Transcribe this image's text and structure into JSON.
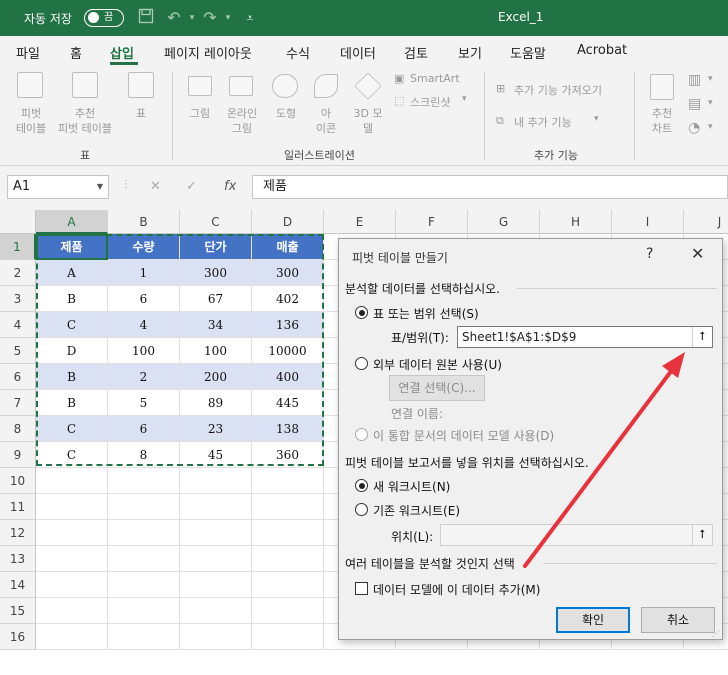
{
  "titlebar": {
    "autosave_label": "자동 저장",
    "autosave_state": "끔",
    "window_title": "Excel_1"
  },
  "tabs": [
    "파일",
    "홈",
    "삽입",
    "페이지 레이아웃",
    "수식",
    "데이터",
    "검토",
    "보기",
    "도움말",
    "Acrobat"
  ],
  "active_tab": "삽입",
  "ribbon": {
    "pivot_label_1": "피벗",
    "pivot_label_2": "테이블",
    "rec_pivot_1": "추천",
    "rec_pivot_2": "피벗 테이블",
    "table_label": "표",
    "group_table": "표",
    "pictures": "그림",
    "online_1": "온라인",
    "online_2": "그림",
    "shapes": "도형",
    "icons_1": "아",
    "icons_2": "이콘",
    "model3d_1": "3D 모",
    "model3d_2": "델",
    "smartart": "SmartArt",
    "screenshot": "스크린샷",
    "group_illustrations": "일러스트레이션",
    "get_addins": "추가 기능 가져오기",
    "my_addins": "내 추가 기능",
    "group_addins": "추가 기능",
    "rec_charts_1": "추천",
    "rec_charts_2": "차트"
  },
  "formula_bar": {
    "name_box": "A1",
    "fx": "fx",
    "content": "제품"
  },
  "columns": [
    "A",
    "B",
    "C",
    "D",
    "E",
    "F",
    "G",
    "H",
    "I",
    "J"
  ],
  "rows": [
    "1",
    "2",
    "3",
    "4",
    "5",
    "6",
    "7",
    "8",
    "9",
    "10",
    "11",
    "12",
    "13",
    "14",
    "15",
    "16"
  ],
  "table": {
    "headers": [
      "제품",
      "수량",
      "단가",
      "매출"
    ],
    "rows": [
      [
        "A",
        "1",
        "300",
        "300"
      ],
      [
        "B",
        "6",
        "67",
        "402"
      ],
      [
        "C",
        "4",
        "34",
        "136"
      ],
      [
        "D",
        "100",
        "100",
        "10000"
      ],
      [
        "B",
        "2",
        "200",
        "400"
      ],
      [
        "B",
        "5",
        "89",
        "445"
      ],
      [
        "C",
        "6",
        "23",
        "138"
      ],
      [
        "C",
        "8",
        "45",
        "360"
      ]
    ]
  },
  "dialog": {
    "title": "피벗 테이블 만들기",
    "help": "?",
    "close": "✕",
    "section1": "분석할 데이터를 선택하십시오.",
    "opt_range": "표 또는 범위 선택(S)",
    "range_label": "표/범위(T):",
    "range_value": "Sheet1!$A$1:$D$9",
    "opt_external": "외부 데이터 원본 사용(U)",
    "conn_button": "연결 선택(C)...",
    "conn_name": "연결 이름:",
    "opt_model": "이 통합 문서의 데이터 모델 사용(D)",
    "section2": "피벗 테이블 보고서를 넣을 위치를 선택하십시오.",
    "opt_new": "새 워크시트(N)",
    "opt_existing": "기존 워크시트(E)",
    "location_label": "위치(L):",
    "section3": "여러 테이블을 분석할 것인지 선택",
    "add_model": "데이터 모델에 이 데이터 추가(M)",
    "ok": "확인",
    "cancel": "취소"
  },
  "colors": {
    "excel_green": "#217346",
    "table_header": "#4472c4",
    "table_band": "#d9e1f2",
    "arrow": "#e8323c"
  }
}
